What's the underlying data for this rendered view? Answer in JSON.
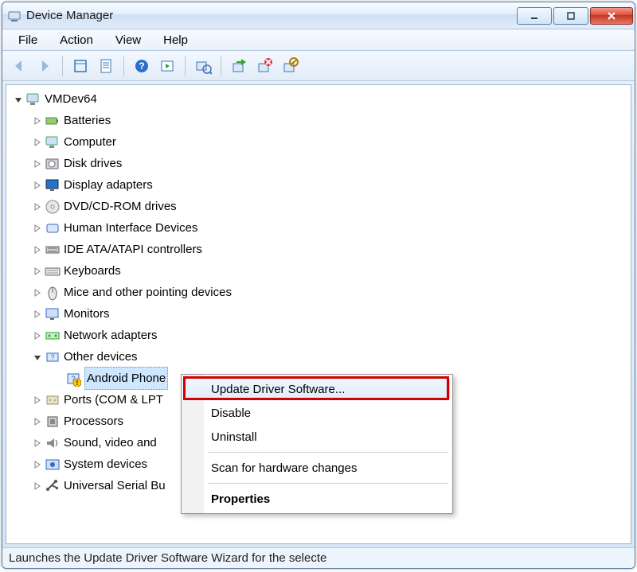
{
  "window": {
    "title": "Device Manager"
  },
  "menu": {
    "items": [
      "File",
      "Action",
      "View",
      "Help"
    ]
  },
  "toolbar": {
    "buttons": [
      {
        "name": "nav-back-icon",
        "disabled": true
      },
      {
        "name": "nav-forward-icon",
        "disabled": true
      },
      {
        "sep": true
      },
      {
        "name": "show-hidden-icon"
      },
      {
        "name": "properties-sheet-icon"
      },
      {
        "sep": true
      },
      {
        "name": "help-icon"
      },
      {
        "name": "action-icon"
      },
      {
        "sep": true
      },
      {
        "name": "scan-hardware-icon"
      },
      {
        "sep": true
      },
      {
        "name": "update-driver-icon"
      },
      {
        "name": "uninstall-device-icon"
      },
      {
        "name": "disable-device-icon"
      }
    ]
  },
  "tree": {
    "root": {
      "label": "VMDev64",
      "icon": "computer-icon",
      "expanded": true
    },
    "children": [
      {
        "label": "Batteries",
        "icon": "battery-icon"
      },
      {
        "label": "Computer",
        "icon": "computer-icon"
      },
      {
        "label": "Disk drives",
        "icon": "disk-icon"
      },
      {
        "label": "Display adapters",
        "icon": "display-icon"
      },
      {
        "label": "DVD/CD-ROM drives",
        "icon": "dvd-icon"
      },
      {
        "label": "Human Interface Devices",
        "icon": "hid-icon"
      },
      {
        "label": "IDE ATA/ATAPI controllers",
        "icon": "ide-icon"
      },
      {
        "label": "Keyboards",
        "icon": "keyboard-icon"
      },
      {
        "label": "Mice and other pointing devices",
        "icon": "mouse-icon"
      },
      {
        "label": "Monitors",
        "icon": "monitor-icon"
      },
      {
        "label": "Network adapters",
        "icon": "network-icon"
      },
      {
        "label": "Other devices",
        "icon": "other-icon",
        "expanded": true,
        "children": [
          {
            "label": "Android Phone",
            "icon": "unknown-device-icon",
            "selected": true,
            "warning": true
          }
        ]
      },
      {
        "label": "Ports (COM & LPT",
        "icon": "port-icon"
      },
      {
        "label": "Processors",
        "icon": "cpu-icon"
      },
      {
        "label": "Sound, video and",
        "icon": "sound-icon"
      },
      {
        "label": "System devices",
        "icon": "system-icon"
      },
      {
        "label": "Universal Serial Bu",
        "icon": "usb-icon"
      }
    ]
  },
  "context_menu": {
    "items": [
      {
        "label": "Update Driver Software...",
        "hover": true,
        "highlight": true
      },
      {
        "label": "Disable"
      },
      {
        "label": "Uninstall"
      },
      {
        "sep": true
      },
      {
        "label": "Scan for hardware changes"
      },
      {
        "sep": true
      },
      {
        "label": "Properties",
        "bold": true
      }
    ]
  },
  "status": {
    "text": "Launches the Update Driver Software Wizard for the selecte"
  }
}
